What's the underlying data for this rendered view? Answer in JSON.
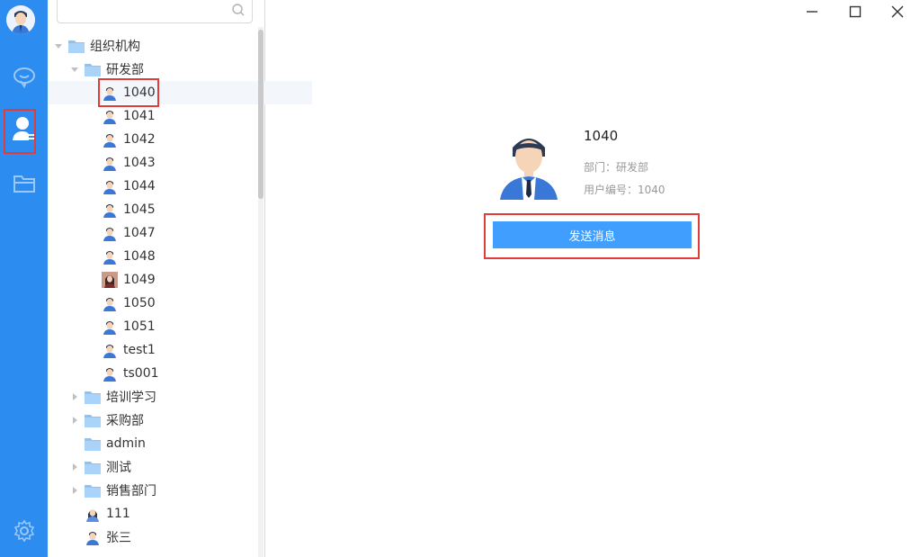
{
  "colors": {
    "sidebar": "#2d8cf0",
    "button": "#409eff",
    "highlight": "#e23b3b"
  },
  "sidebar": {
    "icons": [
      "user-avatar-icon",
      "chat-bubble-icon",
      "contacts-icon",
      "folder-icon",
      "settings-icon"
    ],
    "active": "contacts-icon"
  },
  "tree": {
    "root": "组织机构",
    "dept_rd": "研发部",
    "members": [
      "1040",
      "1041",
      "1042",
      "1043",
      "1044",
      "1045",
      "1047",
      "1048",
      "1049",
      "1050",
      "1051",
      "test1",
      "ts001"
    ],
    "other_depts": [
      "培训学习",
      "采购部",
      "admin",
      "测试",
      "销售部门"
    ],
    "root_users": [
      "111",
      "张三"
    ],
    "selected": "1040"
  },
  "profile": {
    "name": "1040",
    "dept": "部门：研发部",
    "uid": "用户编号：1040",
    "send_label": "发送消息"
  }
}
